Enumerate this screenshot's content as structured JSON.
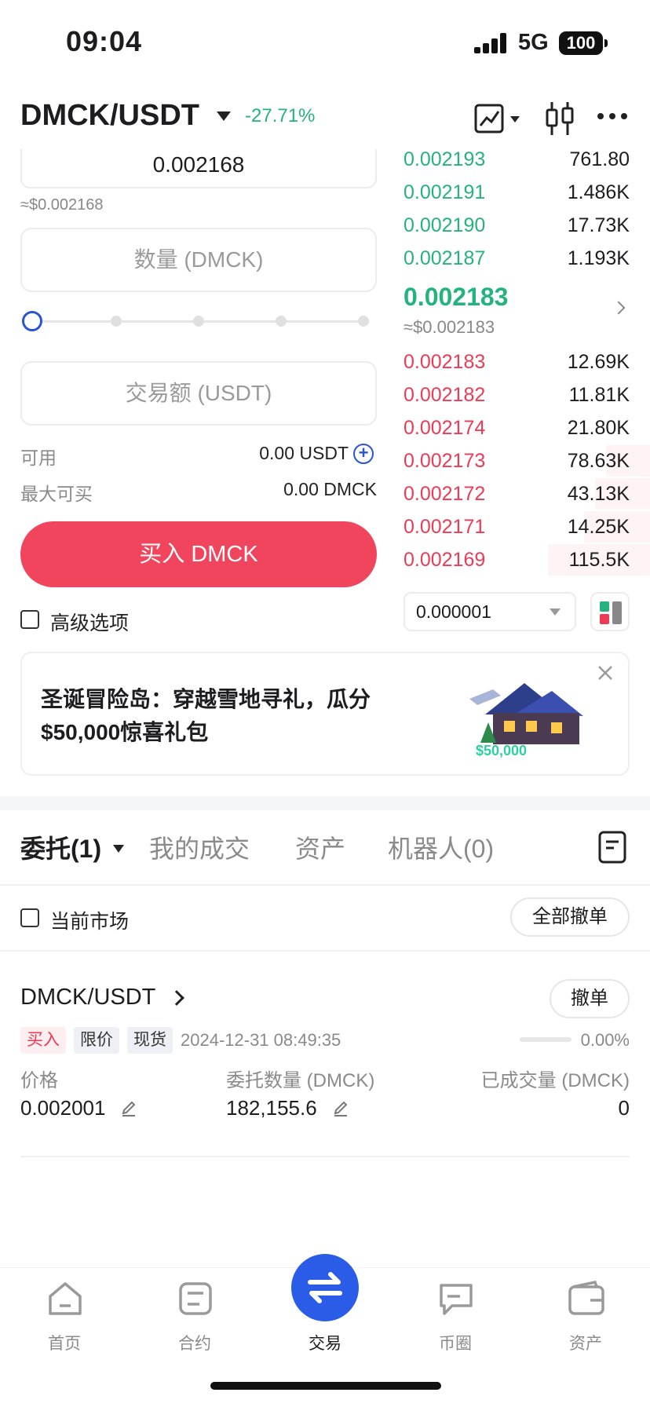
{
  "status": {
    "time": "09:04",
    "network": "5G",
    "battery": "100"
  },
  "header": {
    "pair": "DMCK/USDT",
    "change": "-27.71%"
  },
  "form": {
    "price_value": "0.002168",
    "price_usd": "≈$0.002168",
    "quantity_placeholder": "数量 (DMCK)",
    "amount_placeholder": "交易额 (USDT)",
    "available_label": "可用",
    "available_value": "0.00 USDT",
    "max_buy_label": "最大可买",
    "max_buy_value": "0.00 DMCK",
    "buy_button": "买入 DMCK",
    "advanced_label": "高级选项"
  },
  "orderbook": {
    "asks": [
      {
        "price": "0.002193",
        "qty": "761.80"
      },
      {
        "price": "0.002191",
        "qty": "1.486K"
      },
      {
        "price": "0.002190",
        "qty": "17.73K"
      },
      {
        "price": "0.002187",
        "qty": "1.193K"
      }
    ],
    "last_price": "0.002183",
    "last_price_usd": "≈$0.002183",
    "bids": [
      {
        "price": "0.002183",
        "qty": "12.69K"
      },
      {
        "price": "0.002182",
        "qty": "11.81K"
      },
      {
        "price": "0.002174",
        "qty": "21.80K"
      },
      {
        "price": "0.002173",
        "qty": "78.63K"
      },
      {
        "price": "0.002172",
        "qty": "43.13K"
      },
      {
        "price": "0.002171",
        "qty": "14.25K"
      },
      {
        "price": "0.002169",
        "qty": "115.5K"
      }
    ],
    "precision": "0.000001"
  },
  "banner": {
    "text": "圣诞冒险岛：穿越雪地寻礼，瓜分 $50,000惊喜礼包",
    "art_text": "$50,000"
  },
  "tabs": [
    {
      "label": "委托(1)"
    },
    {
      "label": "我的成交"
    },
    {
      "label": "资产"
    },
    {
      "label": "机器人(0)"
    }
  ],
  "filter": {
    "current_market": "当前市场",
    "cancel_all": "全部撤单"
  },
  "order": {
    "pair": "DMCK/USDT",
    "cancel": "撤单",
    "tags": {
      "side": "买入",
      "type": "限价",
      "market": "现货"
    },
    "time": "2024-12-31 08:49:35",
    "progress": "0.00%",
    "progress_fraction": 0,
    "price_label": "价格",
    "price_value": "0.002001",
    "qty_label": "委托数量 (DMCK)",
    "qty_value": "182,155.6",
    "filled_label": "已成交量 (DMCK)",
    "filled_value": "0"
  },
  "nav": [
    {
      "label": "首页",
      "icon": "home-icon"
    },
    {
      "label": "合约",
      "icon": "futures-icon"
    },
    {
      "label": "交易",
      "icon": "swap-icon"
    },
    {
      "label": "币圈",
      "icon": "chat-icon"
    },
    {
      "label": "资产",
      "icon": "wallet-icon"
    }
  ],
  "colors": {
    "buy": "#ee3b55",
    "ask": "#25b37d",
    "accent": "#2a5ce8",
    "buy_button": "#f0455c"
  }
}
